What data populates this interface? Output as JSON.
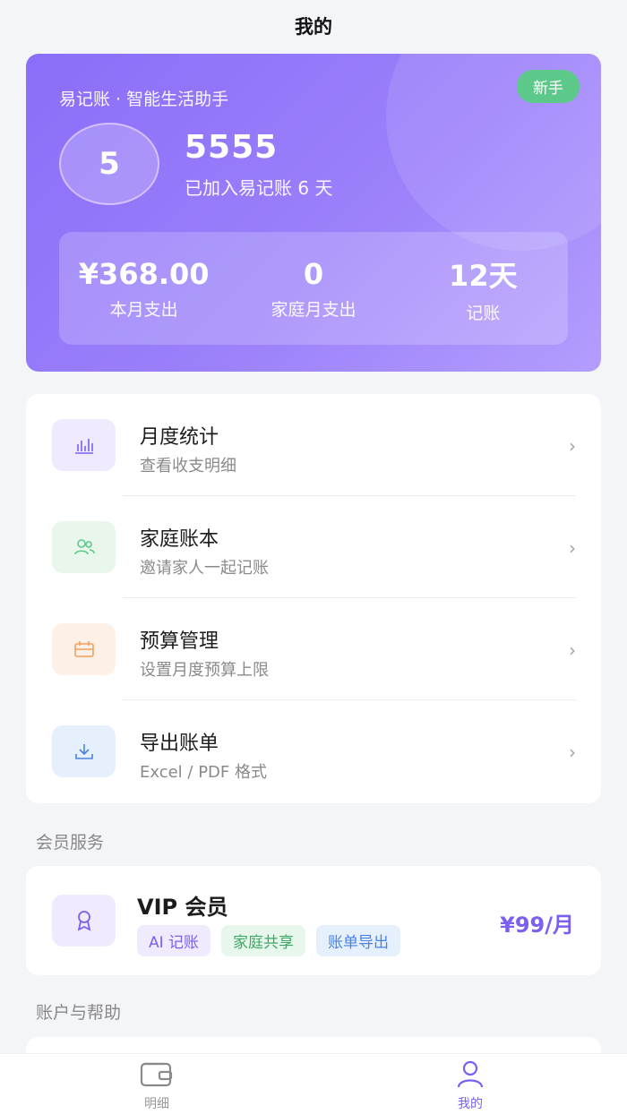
{
  "header": {
    "title": "我的"
  },
  "profile": {
    "subtitle": "易记账 · 智能生活助手",
    "badge": "新手",
    "avatar_initial": "5",
    "username": "5555",
    "joined_text": "已加入易记账 6 天",
    "stats": [
      {
        "value": "¥368.00",
        "label": "本月支出"
      },
      {
        "value": "0",
        "label": "家庭月支出"
      },
      {
        "value": "12天",
        "label": "记账"
      }
    ]
  },
  "menu": {
    "items": [
      {
        "title": "月度统计",
        "desc": "查看收支明细",
        "icon": "bar-chart-icon",
        "icon_bg": "#efeafd",
        "icon_color": "#7b5ff0"
      },
      {
        "title": "家庭账本",
        "desc": "邀请家人一起记账",
        "icon": "users-icon",
        "icon_bg": "#e8f6ec",
        "icon_color": "#5cc98a"
      },
      {
        "title": "预算管理",
        "desc": "设置月度预算上限",
        "icon": "calendar-icon",
        "icon_bg": "#fdf1e7",
        "icon_color": "#f0a060"
      },
      {
        "title": "导出账单",
        "desc": "Excel / PDF 格式",
        "icon": "download-icon",
        "icon_bg": "#e6f0fd",
        "icon_color": "#4a82e0"
      }
    ]
  },
  "membership": {
    "section_label": "会员服务",
    "title": "VIP 会员",
    "tags": [
      "AI 记账",
      "家庭共享",
      "账单导出"
    ],
    "price": "¥99/月"
  },
  "account": {
    "section_label": "账户与帮助"
  },
  "tabbar": {
    "tabs": [
      {
        "label": "明细",
        "icon": "wallet-icon",
        "active": false
      },
      {
        "label": "我的",
        "icon": "user-icon",
        "active": true
      }
    ]
  },
  "colors": {
    "accent": "#7b5ff0",
    "hero_start": "#8a6ef8",
    "hero_end": "#b39dfd",
    "badge": "#5cc98a"
  }
}
